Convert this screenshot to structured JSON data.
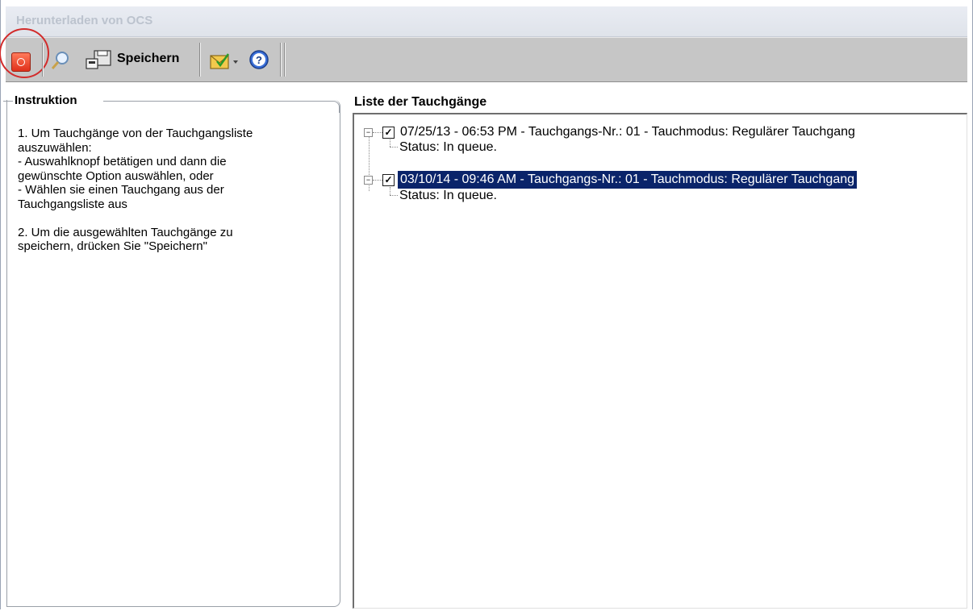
{
  "window": {
    "title": "Herunterladen von OCS"
  },
  "toolbar": {
    "save_label": "Speichern",
    "icons": [
      "power-icon",
      "search-icon",
      "save-disk-icon",
      "mail-dropdown-icon",
      "help-icon"
    ]
  },
  "instructions": {
    "title": "Instruktion",
    "lines": [
      "1. Um Tauchgänge von der Tauchgangsliste",
      "auszuwählen:",
      "- Auswahlknopf betätigen und dann die",
      "gewünschte Option auswählen, oder",
      "- Wählen sie einen Tauchgang aus der",
      "Tauchgangsliste aus",
      "",
      "2. Um die ausgewählten Tauchgänge zu",
      "speichern, drücken Sie \"Speichern\""
    ]
  },
  "dive_list": {
    "title": "Liste der Tauchgänge",
    "items": [
      {
        "label": "07/25/13 - 06:53 PM - Tauchgangs-Nr.: 01 - Tauchmodus: Regulärer Tauchgang",
        "status": "Status: In queue.",
        "checked": true,
        "selected": false
      },
      {
        "label": "03/10/14 - 09:46 AM - Tauchgangs-Nr.: 01 - Tauchmodus: Regulärer Tauchgang",
        "status": "Status: In queue.",
        "checked": true,
        "selected": true
      }
    ]
  },
  "colors": {
    "selection": "#0a246a",
    "highlight_circle": "#d22b2b",
    "toolbar": "#c6c6c6"
  }
}
